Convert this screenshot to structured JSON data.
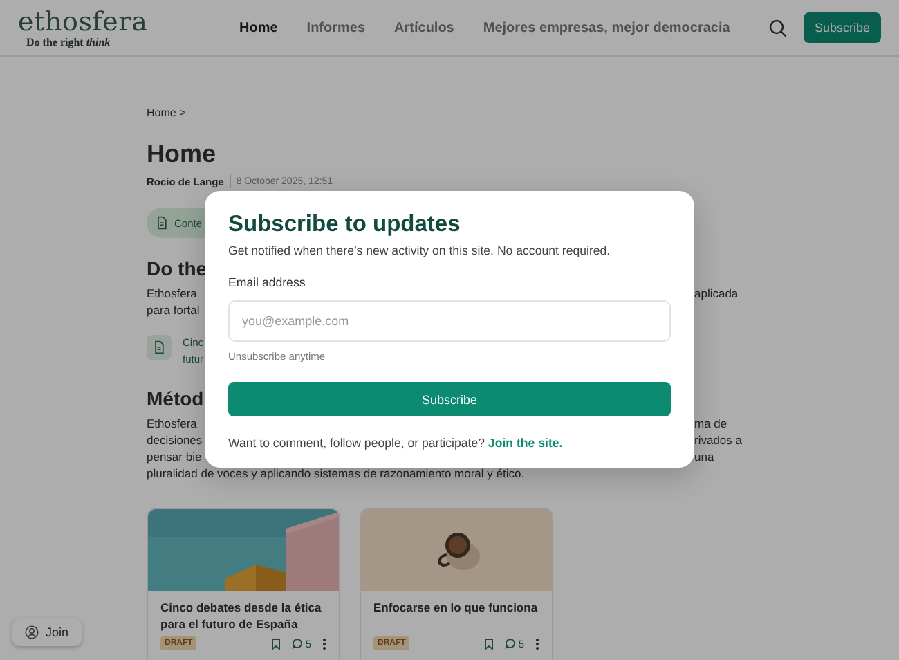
{
  "header": {
    "logo": "ethosfera",
    "tagline": "Do the right *think*",
    "nav": [
      {
        "label": "Home",
        "selected": true
      },
      {
        "label": "Informes",
        "selected": false
      },
      {
        "label": "Artículos",
        "selected": false
      },
      {
        "label": "Mejores empresas, mejor democracia",
        "selected": false
      }
    ],
    "subscribe": "Subscribe"
  },
  "breadcrumb": "Home >",
  "title": "Home",
  "author": "Rocio de Lange",
  "date": "8 October 2025, 12:51",
  "chip": "Conte",
  "sections": [
    {
      "heading": "Do the",
      "lines": [
        {
          "left": "Ethosfera",
          "right": "aplicada"
        },
        {
          "left": "para fortal"
        }
      ],
      "item": [
        "Cinc",
        "futur"
      ]
    },
    {
      "heading": "Métod",
      "lines": [
        {
          "left": "Ethosfera",
          "right": "ma de"
        },
        {
          "left": "decisiones",
          "right": "rivados a"
        },
        {
          "left": "pensar bie",
          "right": "una"
        },
        {
          "left": "pluralidad de voces y aplicando sistemas de razonamiento moral y ético."
        }
      ]
    }
  ],
  "cards": [
    {
      "title": "Cinco debates desde la ética para el futuro de España",
      "badge": "DRAFT",
      "comments": "5"
    },
    {
      "title": "Enfocarse en lo que funciona",
      "badge": "DRAFT",
      "comments": "5"
    }
  ],
  "join": "Join",
  "modal": {
    "title": "Subscribe to updates",
    "subtitle": "Get notified when there’s new activity on this site. No account required.",
    "email_label": "Email address",
    "placeholder": "you@example.com",
    "hint": "Unsubscribe anytime",
    "button": "Subscribe",
    "footer": "Want to comment, follow people, or participate?",
    "link": "Join the site."
  }
}
